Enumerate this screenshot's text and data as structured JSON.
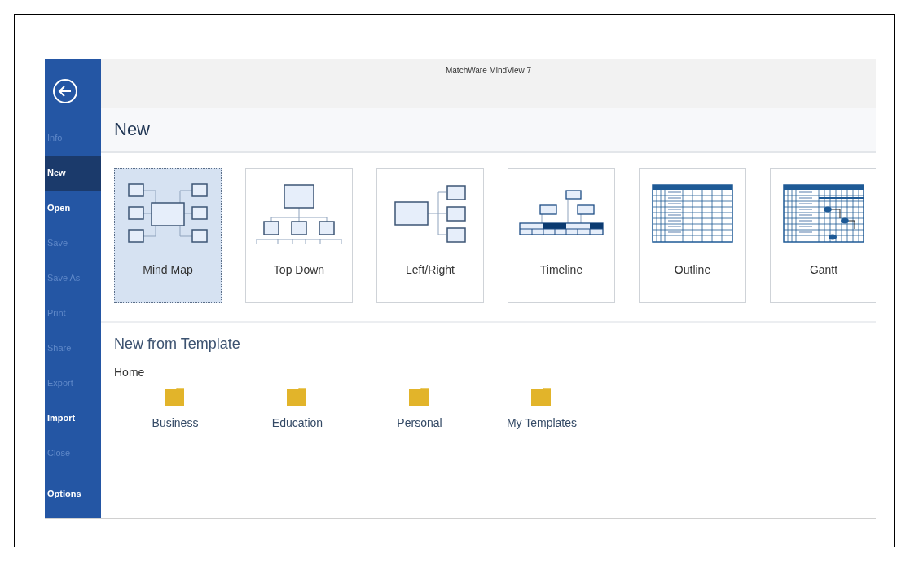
{
  "window": {
    "title": "MatchWare MindView 7"
  },
  "sidebar": {
    "items": [
      {
        "label": "Info",
        "selected": false,
        "disabled": true
      },
      {
        "label": "New",
        "selected": true,
        "disabled": false
      },
      {
        "label": "Open",
        "selected": false,
        "disabled": false
      },
      {
        "label": "Save",
        "selected": false,
        "disabled": true
      },
      {
        "label": "Save As",
        "selected": false,
        "disabled": true
      },
      {
        "label": "Print",
        "selected": false,
        "disabled": true
      },
      {
        "label": "Share",
        "selected": false,
        "disabled": true
      },
      {
        "label": "Export",
        "selected": false,
        "disabled": true
      },
      {
        "label": "Import",
        "selected": false,
        "disabled": false
      },
      {
        "label": "Close",
        "selected": false,
        "disabled": true
      },
      {
        "label": "Options",
        "selected": false,
        "disabled": false
      }
    ]
  },
  "page_title": "New",
  "views": [
    {
      "label": "Mind Map",
      "kind": "mindmap",
      "selected": true
    },
    {
      "label": "Top Down",
      "kind": "topdown",
      "selected": false
    },
    {
      "label": "Left/Right",
      "kind": "leftright",
      "selected": false
    },
    {
      "label": "Timeline",
      "kind": "timeline",
      "selected": false
    },
    {
      "label": "Outline",
      "kind": "outline",
      "selected": false
    },
    {
      "label": "Gantt",
      "kind": "gantt",
      "selected": false
    }
  ],
  "templates": {
    "title": "New from Template",
    "path": "Home",
    "folders": [
      {
        "label": "Business"
      },
      {
        "label": "Education"
      },
      {
        "label": "Personal"
      },
      {
        "label": "My Templates"
      }
    ]
  }
}
